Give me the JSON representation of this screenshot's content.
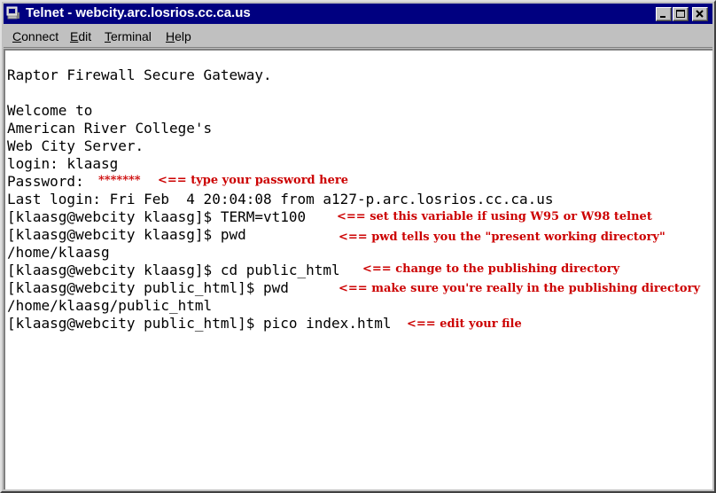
{
  "window": {
    "title": "Telnet - webcity.arc.losrios.cc.ca.us",
    "controls": {
      "minimize": "minimize-icon",
      "maximize": "maximize-icon",
      "close": "close-icon"
    }
  },
  "menu": {
    "items": [
      {
        "label": "Connect",
        "accel": "C",
        "rest": "onnect"
      },
      {
        "label": "Edit",
        "accel": "E",
        "rest": "dit"
      },
      {
        "label": "Terminal",
        "accel": "T",
        "rest": "erminal"
      },
      {
        "label": "Help",
        "accel": "H",
        "rest": "elp"
      }
    ]
  },
  "terminal": {
    "lines": [
      "Raptor Firewall Secure Gateway.",
      "",
      "Welcome to",
      "American River College's",
      "Web City Server.",
      "login: klaasg",
      "Password:",
      "Last login: Fri Feb  4 20:04:08 from a127-p.arc.losrios.cc.ca.us",
      "[klaasg@webcity klaasg]$ TERM=vt100",
      "[klaasg@webcity klaasg]$ pwd",
      "/home/klaasg",
      "[klaasg@webcity klaasg]$ cd public_html",
      "[klaasg@webcity public_html]$ pwd",
      "/home/klaasg/public_html",
      "[klaasg@webcity public_html]$ pico index.html"
    ],
    "password_mask": "*******",
    "annotations": {
      "password": "<== type your password here",
      "term": "<== set this variable if using W95 or W98 telnet",
      "pwd1": "<== pwd tells you the \"present working directory\"",
      "cd": "<== change to the publishing directory",
      "pwd2": "<== make sure you're really in the publishing directory",
      "pico": "<== edit your file"
    },
    "annotation_color": "#cc0000"
  }
}
